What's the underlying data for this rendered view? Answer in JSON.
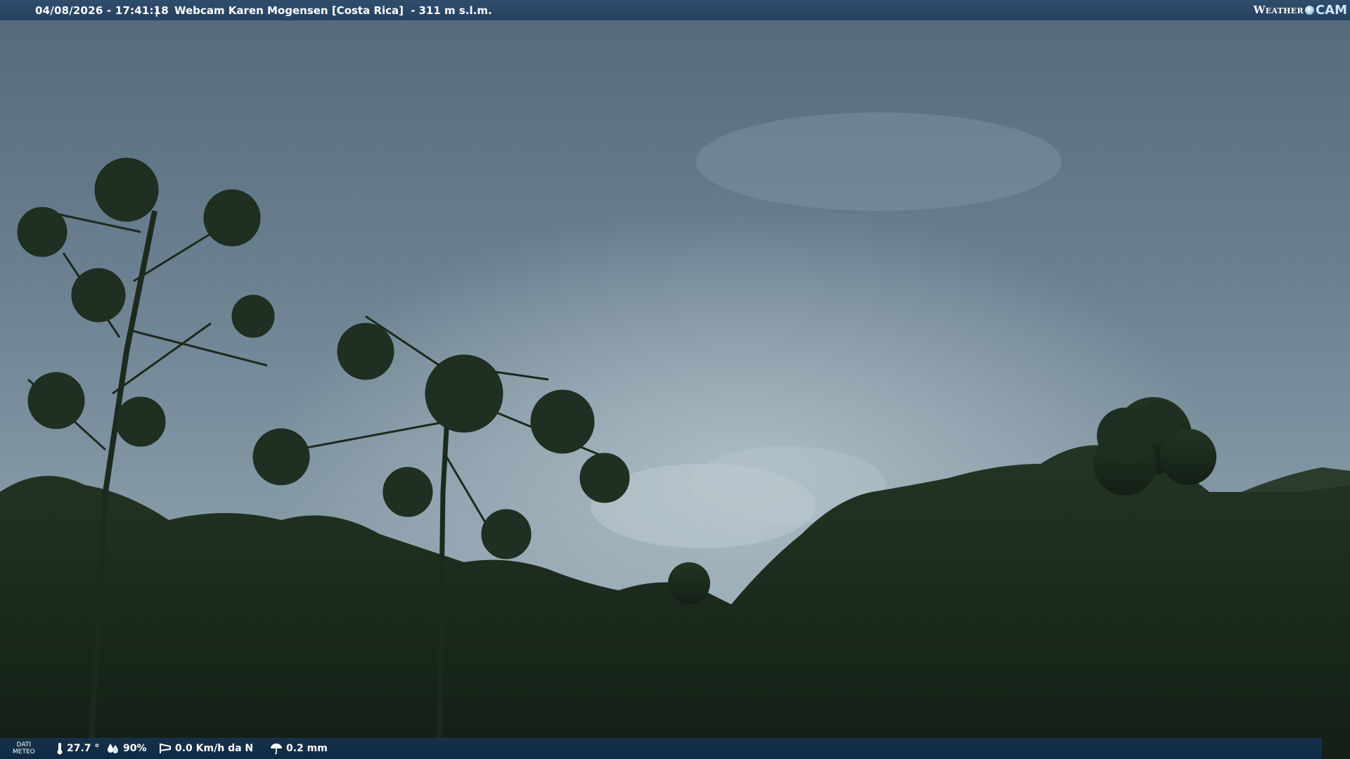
{
  "overlay": {
    "datetime": "04/08/2026 - 17:41:18",
    "separator": "|",
    "title": "Webcam Karen Mogensen [Costa Rica]",
    "altitude": "311 m s.l.m.",
    "brand_weather": "Weather",
    "brand_cam": "CAM"
  },
  "meteo": {
    "label_line1": "DATI",
    "label_line2": "METEO",
    "temperature": "27.7 °",
    "humidity": "90%",
    "wind": "0.0 Km/h da N",
    "rain": "0.2 mm"
  },
  "colors": {
    "top_bar": "#2f4c6c",
    "bottom_bar": "#0f2a44",
    "sky": "#6f8494",
    "vegetation": "#1f2d1f"
  }
}
